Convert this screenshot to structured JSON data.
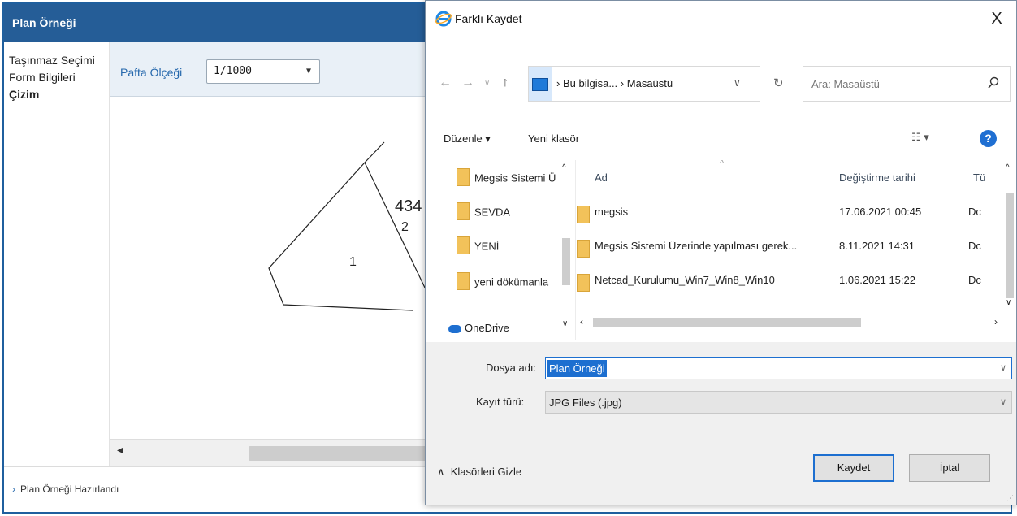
{
  "app": {
    "title": "Plan Örneği",
    "sidebar": [
      {
        "label": "Taşınmaz Seçimi"
      },
      {
        "label": "Form Bilgileri"
      },
      {
        "label": "Çizim"
      }
    ],
    "scale_label": "Pafta Ölçeği",
    "scale_value": "1/1000",
    "drawing": {
      "parcel_1": "1",
      "parcel_2": "2",
      "block_number": "434"
    },
    "status_text": "Plan Örneği Hazırlandı"
  },
  "dialog": {
    "title": "Farklı Kaydet",
    "close_label": "X",
    "breadcrumb": {
      "root": "Bu bilgisa...",
      "sep": "›",
      "current": "Masaüstü"
    },
    "search_placeholder": "Ara: Masaüstü",
    "toolbar": {
      "organize": "Düzenle ▾",
      "new_folder": "Yeni klasör",
      "help": "?"
    },
    "nav_items": [
      {
        "label": "Megsis Sistemi Ü"
      },
      {
        "label": "SEVDA"
      },
      {
        "label": "YENİ"
      },
      {
        "label": "yeni dökümanla"
      }
    ],
    "onedrive_label": "OneDrive",
    "columns": {
      "name": "Ad",
      "date": "Değiştirme tarihi",
      "type": "Tü"
    },
    "files": [
      {
        "name": "megsis",
        "date": "17.06.2021 00:45",
        "type": "Dc"
      },
      {
        "name": "Megsis Sistemi Üzerinde yapılması gerek...",
        "date": "8.11.2021 14:31",
        "type": "Dc"
      },
      {
        "name": "Netcad_Kurulumu_Win7_Win8_Win10",
        "date": "1.06.2021 15:22",
        "type": "Dc"
      }
    ],
    "filename_label": "Dosya adı:",
    "filename_value": "Plan Örneği",
    "filetype_label": "Kayıt türü:",
    "filetype_value": "JPG Files (.jpg)",
    "hide_folders": "Klasörleri Gizle",
    "save_label": "Kaydet",
    "cancel_label": "İptal"
  },
  "colors": {
    "app_title_bg": "#255d97",
    "accent": "#1d6fd0",
    "link_blue": "#2769ad"
  }
}
